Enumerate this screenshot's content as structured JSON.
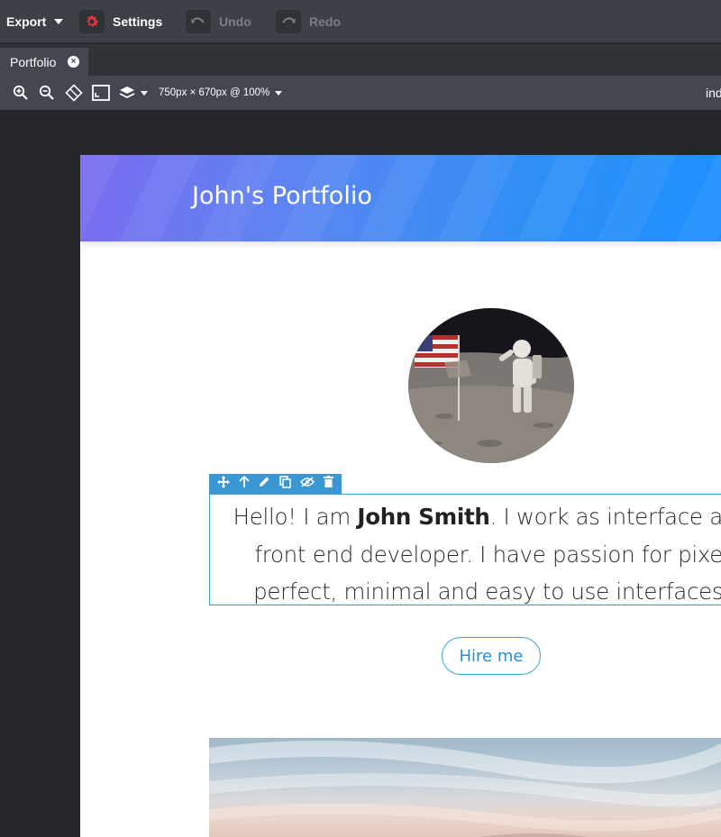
{
  "topbar": {
    "export_label": "Export",
    "settings_label": "Settings",
    "undo_label": "Undo",
    "redo_label": "Redo",
    "settings_icon_color": "#e8323c"
  },
  "tabs": [
    {
      "label": "Portfolio",
      "close": "×"
    }
  ],
  "canvas_toolbar": {
    "size_label": "750px × 670px @ 100%",
    "file_label": "inde"
  },
  "page": {
    "header_title": "John's Portfolio",
    "bio": {
      "prefix": "Hello! I am ",
      "name": "John Smith",
      "suffix": ". I work as interface and front end developer. I have passion for pixel perfect, minimal and easy to use interfaces."
    },
    "hire_button": "Hire me"
  },
  "selection_toolbar": {
    "icons": [
      "move-icon",
      "arrow-up-icon",
      "pencil-icon",
      "copy-icon",
      "eye-off-icon",
      "trash-icon"
    ]
  },
  "colors": {
    "accent": "#3b97d3",
    "header_gradient_start": "#7b6cf0",
    "header_gradient_end": "#1e90ff"
  }
}
